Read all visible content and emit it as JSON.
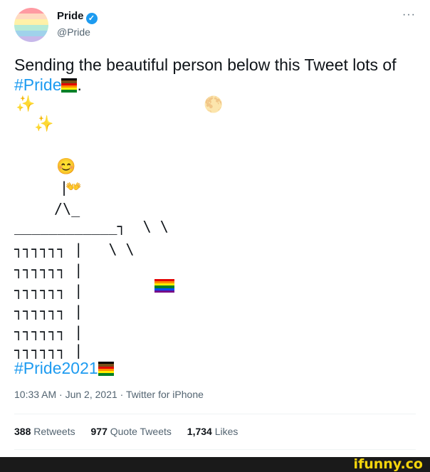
{
  "account": {
    "name": "Pride",
    "handle": "@Pride",
    "verified_icon": "verified-badge-icon"
  },
  "menu": {
    "more_label": "···"
  },
  "tweet": {
    "text_line1": "Sending the beautiful person below this Tweet lots of",
    "hashtag": "#Pride",
    "text_end": ".",
    "bottom_hashtag": "#Pride2021"
  },
  "art": {
    "row_top": "____________┐  \\ \\",
    "row1": "┐┐┐┐┐┐ |   \\ \\",
    "row2": "┐┐┐┐┐┐ |",
    "row3": "┐┐┐┐┐┐ |",
    "row4": "┐┐┐┐┐┐ |",
    "row5": "┐┐┐┐┐┐ |",
    "row6": "┐┐┐┐┐┐ |",
    "stick_body": "|",
    "stick_legs": "/\\_",
    "sparkles": "✨",
    "moon": "🌕",
    "face": "😊",
    "hands": "👐"
  },
  "meta": {
    "timestamp": "10:33 AM · Jun 2, 2021 · Twitter for iPhone"
  },
  "stats": {
    "retweets_count": "388",
    "retweets_label": "Retweets",
    "quotes_count": "977",
    "quotes_label": "Quote Tweets",
    "likes_count": "1,734",
    "likes_label": "Likes"
  },
  "watermark": {
    "text": "ifunny.co"
  },
  "colors": {
    "link": "#1d9bf0",
    "avatar_stripes": [
      "#ff9aa2",
      "#ffdac1",
      "#fff1a8",
      "#b5ead7",
      "#a0d2eb",
      "#c7b8ea"
    ],
    "rainbow_flag": [
      "#e40303",
      "#ff8c00",
      "#ffed00",
      "#008026",
      "#004dff",
      "#750787"
    ],
    "progress_flag": [
      "#000000",
      "#784f17",
      "#e40303",
      "#ff8c00",
      "#ffed00",
      "#008026"
    ]
  }
}
